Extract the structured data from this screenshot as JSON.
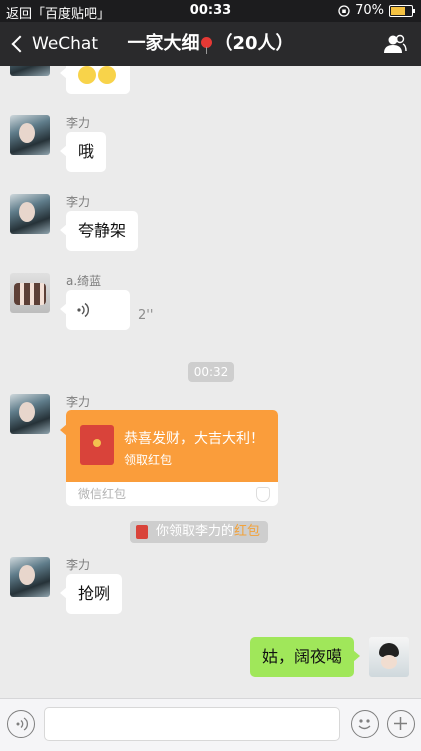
{
  "status_bar": {
    "back_label": "返回「百度贴吧」",
    "time": "00:33",
    "battery_percent": "70%",
    "battery_level": 0.7
  },
  "nav": {
    "back_label": "WeChat",
    "title_prefix": "一家大细",
    "title_suffix": "（20人）"
  },
  "messages": {
    "m0": {
      "emoji_count": 2
    },
    "m1": {
      "sender": "李力",
      "text": "哦"
    },
    "m2": {
      "sender": "李力",
      "text": "夸静架"
    },
    "m3": {
      "sender": "a.绮蓝",
      "voice_duration": "2''"
    },
    "timestamp": "00:32",
    "m4": {
      "sender": "李力",
      "title": "恭喜发财，大吉大利！",
      "subtitle": "领取红包",
      "footer": "微信红包"
    },
    "notice": {
      "prefix": "你领取李力的",
      "highlight": "红包"
    },
    "m5": {
      "sender": "李力",
      "text": "抢咧"
    },
    "m6": {
      "text": "姑，阔夜噶"
    }
  },
  "colors": {
    "nav_bg": "#2a2a2c",
    "chat_bg": "#ebebeb",
    "outgoing_bubble": "#a0e75a",
    "red_packet": "#fa9d3b"
  }
}
